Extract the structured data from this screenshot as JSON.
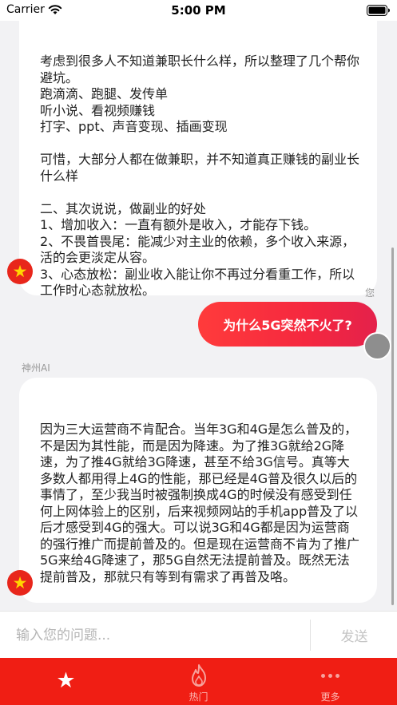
{
  "status_bar": {
    "carrier": "Carrier",
    "time": "5:00 PM"
  },
  "chat": {
    "messages": [
      {
        "role": "ai",
        "text": "考虑到很多人不知道兼职长什么样，所以整理了几个帮你避坑。\n跑滴滴、跑腿、发传单\n听小说、看视频赚钱\n打字、ppt、声音变现、插画变现\n\n可惜，大部分人都在做兼职，并不知道真正赚钱的副业长什么样\n\n二、其次说说，做副业的好处\n1、增加收入：一直有额外是收入，才能存下钱。\n2、不畏首畏尾：能减少对主业的依赖，多个收入来源，活的会更淡定从容。\n3、心态放松：副业收入能让你不再过分看重工作，所以工作时心态就放松。"
      },
      {
        "role": "user",
        "sender_name": "您",
        "text": "为什么5G突然不火了?"
      },
      {
        "role": "ai",
        "sender_name": "神州AI",
        "text": "因为三大运营商不肯配合。当年3G和4G是怎么普及的，不是因为其性能，而是因为降速。为了推3G就给2G降速，为了推4G就给3G降速，甚至不给3G信号。真等大多数人都用得上4G的性能，那已经是4G普及很久以后的事情了，至少我当时被强制换成4G的时候没有感受到任何上网体验上的区别，后来视频网站的手机app普及了以后才感受到4G的强大。可以说3G和4G都是因为运营商的强行推广而提前普及的。但是现在运营商不肯为了推广5G来给4G降速了，那5G自然无法提前普及。既然无法提前普及，那就只有等到有需求了再普及咯。"
      }
    ]
  },
  "input": {
    "placeholder": "输入您的问题...",
    "value": "",
    "send_label": "发送"
  },
  "tab_bar": {
    "tabs": [
      {
        "label": "",
        "icon": "star-icon"
      },
      {
        "label": "热门",
        "icon": "flame-icon"
      },
      {
        "label": "更多",
        "icon": "more-dots-icon"
      }
    ]
  },
  "colors": {
    "tab_bar_red": "#f01e14",
    "user_bubble_gradient_start": "#ff3b3b",
    "user_bubble_gradient_end": "#e4214b",
    "chat_background": "#f2f2f4",
    "avatar_star_yellow": "#ffd600"
  }
}
